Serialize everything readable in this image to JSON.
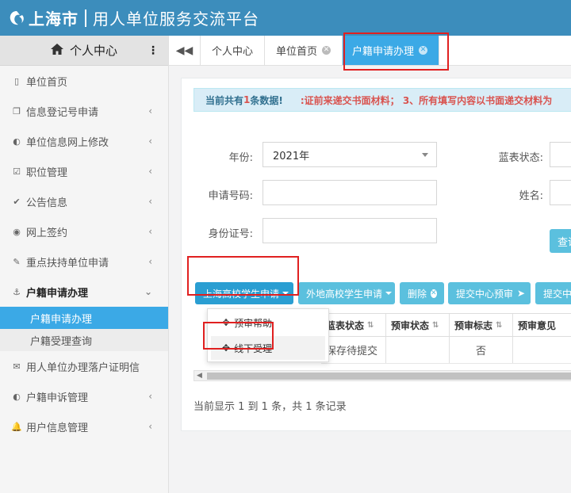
{
  "header": {
    "logo_text": "上海市",
    "title": "用人单位服务交流平台"
  },
  "sidebar": {
    "top_label": "个人中心",
    "items": [
      {
        "label": "单位首页",
        "icon": "bookmark-icon",
        "glyph": "▯",
        "chevron": false
      },
      {
        "label": "信息登记号申请",
        "icon": "copy-icon",
        "glyph": "❐",
        "chevron": true
      },
      {
        "label": "单位信息网上修改",
        "icon": "contrast-icon",
        "glyph": "◐",
        "chevron": true
      },
      {
        "label": "职位管理",
        "icon": "checkbox-icon",
        "glyph": "☑",
        "chevron": true
      },
      {
        "label": "公告信息",
        "icon": "check-icon",
        "glyph": "✔",
        "chevron": true
      },
      {
        "label": "网上签约",
        "icon": "eye-icon",
        "glyph": "◉",
        "chevron": true
      },
      {
        "label": "重点扶持单位申请",
        "icon": "pencil-icon",
        "glyph": "✎",
        "chevron": true
      },
      {
        "label": "户籍申请办理",
        "icon": "anchor-icon",
        "glyph": "⚓",
        "chevron": true,
        "open": true
      }
    ],
    "subitems": [
      "户籍申请办理",
      "户籍受理查询"
    ],
    "items_after": [
      {
        "label": "用人单位办理落户证明信",
        "icon": "envelope-icon",
        "glyph": "✉",
        "chevron": false
      },
      {
        "label": "户籍申诉管理",
        "icon": "contrast-icon",
        "glyph": "◐",
        "chevron": true
      },
      {
        "label": "用户信息管理",
        "icon": "bell-icon",
        "glyph": "🔔",
        "chevron": true
      }
    ]
  },
  "tabs": [
    {
      "label": "个人中心",
      "closable": false
    },
    {
      "label": "单位首页",
      "closable": true
    },
    {
      "label": "户籍申请办理",
      "closable": true,
      "active": true
    }
  ],
  "notice": {
    "prefix": "当前共有",
    "count": "1",
    "suffix": "条数据!",
    "scrolling": ":证前来递交书面材料；    3、所有填写内容以书面递交材料为"
  },
  "form": {
    "year_label": "年份:",
    "year_value": "2021年",
    "blue_status_label": "蓝表状态:",
    "apply_no_label": "申请号码:",
    "name_label": "姓名:",
    "id_label": "身份证号:",
    "query_label": "查询"
  },
  "actions": {
    "shanghai_apply": "上海高校学生申请",
    "other_apply": "外地高校学生申请",
    "delete": "删除",
    "submit_center": "提交中心预审",
    "submit_more": "提交中"
  },
  "dropdown": {
    "items": [
      "预审帮助",
      "线下受理"
    ]
  },
  "table": {
    "columns": [
      "蓝表状态",
      "预审状态",
      "预审标志",
      "预审意见"
    ],
    "rows": [
      [
        "保存待提交",
        "",
        "否",
        ""
      ]
    ]
  },
  "pager": "当前显示 1 到 1 条，共 1 条记录",
  "colors": {
    "header": "#3c8dbc",
    "active_tab": "#3ba9e6",
    "button": "#5bc0de",
    "highlight": "#e02020"
  }
}
